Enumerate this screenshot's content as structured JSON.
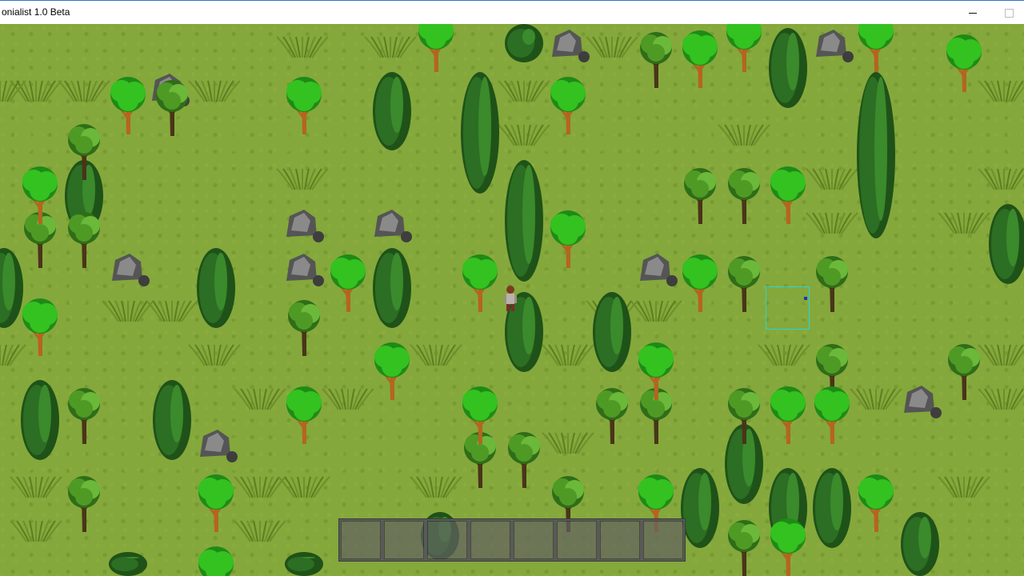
{
  "window": {
    "title": "onialist 1.0 Beta",
    "minimize_icon": "minimize-icon",
    "maximize_icon": "maximize-icon"
  },
  "colors": {
    "grass": "#84a83b",
    "tree_leaf": "#33c21f",
    "tree_leaf_dark": "#1f8a17",
    "oak_leaf": "#4f9a24",
    "trunk": "#b56420",
    "cypress": "#2c6e23",
    "rock": "#6b6b6b",
    "bush": "#6f8f2a",
    "selection": "#2ad6d6"
  },
  "hotbar": {
    "slot_count": 8
  },
  "legend_icons": [
    "leafy-tree-icon",
    "oak-tree-icon",
    "cypress-tree-icon",
    "rock-icon",
    "bush-icon",
    "player-character-icon"
  ]
}
